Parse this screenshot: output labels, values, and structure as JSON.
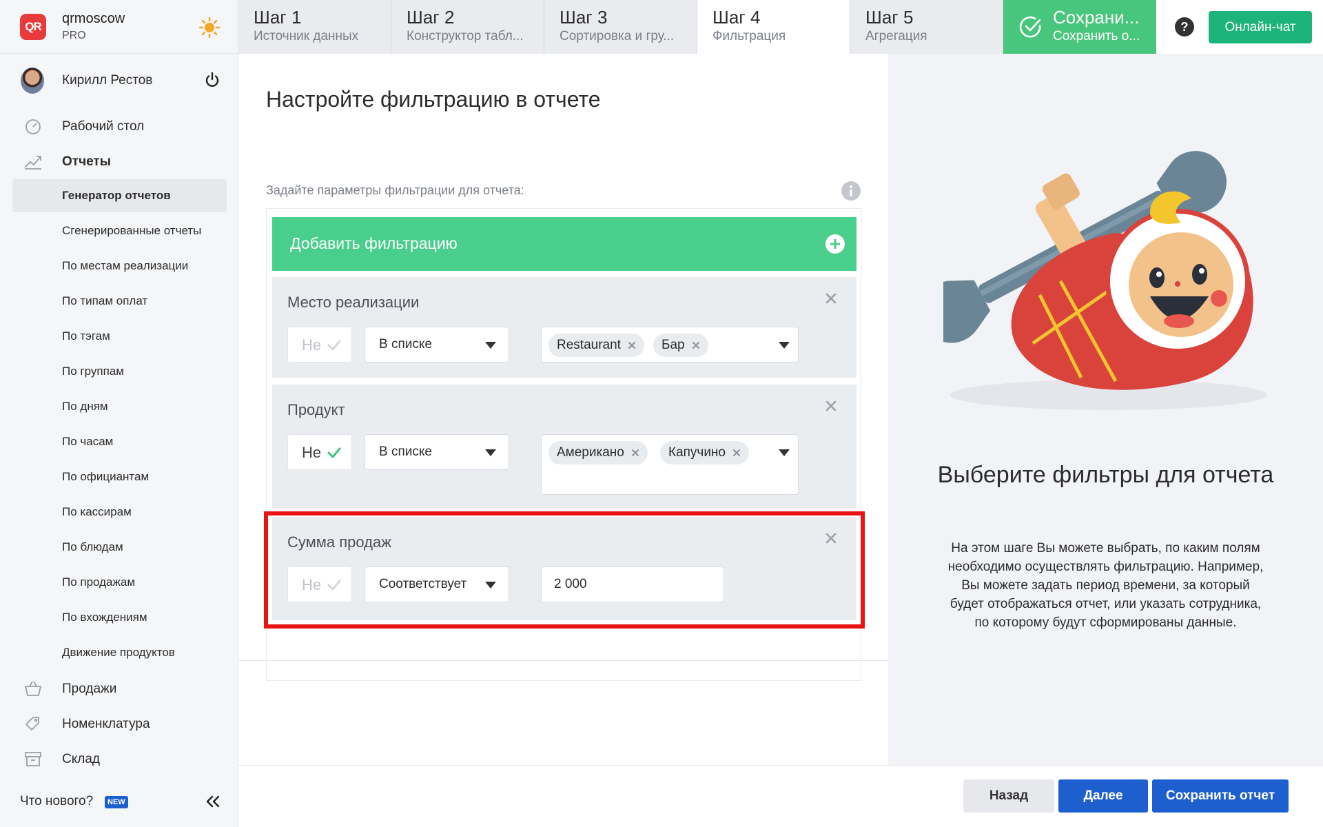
{
  "brand": {
    "logo_text": "QR",
    "name": "qrmoscow",
    "plan": "PRO",
    "accent": "#e83a3a"
  },
  "user": {
    "name": "Кирилл Рестов"
  },
  "nav": {
    "dashboard": "Рабочий стол",
    "reports": "Отчеты",
    "sales": "Продажи",
    "nomenclature": "Номенклатура",
    "warehouse": "Склад"
  },
  "report_items": [
    "Генератор отчетов",
    "Сгенерированные отчеты",
    "По местам реализации",
    "По типам оплат",
    "По тэгам",
    "По группам",
    "По дням",
    "По часам",
    "По официантам",
    "По кассирам",
    "По блюдам",
    "По продажам",
    "По вхождениям",
    "Движение продуктов"
  ],
  "sidebar_footer": {
    "whats_new": "Что нового?",
    "new_badge": "NEW"
  },
  "steps": [
    {
      "title": "Шаг 1",
      "sub": "Источник данных"
    },
    {
      "title": "Шаг 2",
      "sub": "Конструктор табл..."
    },
    {
      "title": "Шаг 3",
      "sub": "Сортировка и гру..."
    },
    {
      "title": "Шаг 4",
      "sub": "Фильтрация"
    },
    {
      "title": "Шаг 5",
      "sub": "Агрегация"
    }
  ],
  "save_step": {
    "title": "Сохрани...",
    "sub": "Сохранить о..."
  },
  "chat_button": "Онлайн-чат",
  "main": {
    "title": "Настройте фильтрацию в отчете",
    "form_label": "Задайте параметры фильтрации для отчета:",
    "add_filter": "Добавить фильтрацию"
  },
  "filters": [
    {
      "title": "Место реализации",
      "neg": "Не",
      "neg_on": false,
      "operator": "В списке",
      "tags": [
        "Restaurant",
        "Бар"
      ]
    },
    {
      "title": "Продукт",
      "neg": "Не",
      "neg_on": true,
      "operator": "В списке",
      "tags": [
        "Американо",
        "Капучино"
      ]
    },
    {
      "title": "Сумма продаж",
      "neg": "Не",
      "neg_on": false,
      "operator": "Соответствует",
      "value": "2 000"
    }
  ],
  "info": {
    "title": "Выберите фильтры для отчета",
    "text": "На этом шаге Вы можете выбрать, по каким полям необходимо осуществлять фильтрацию. Например, Вы можете задать период времени, за который будет отображаться отчет, или указать сотрудника, по которому будут сформированы данные."
  },
  "footer": {
    "back": "Назад",
    "next": "Далее",
    "save": "Сохранить отчет"
  },
  "colors": {
    "green": "#49cf8b",
    "blue": "#1e5fd0",
    "highlight": "#e81313",
    "chat": "#1cb47a"
  }
}
